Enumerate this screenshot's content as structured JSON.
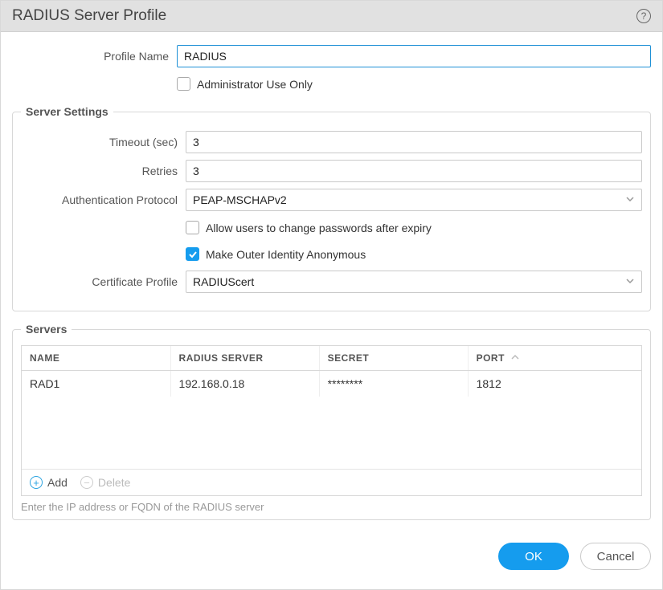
{
  "dialog": {
    "title": "RADIUS Server Profile",
    "help_icon": "?"
  },
  "profile": {
    "name_label": "Profile Name",
    "name_value": "RADIUS",
    "admin_only_label": "Administrator Use Only",
    "admin_only_checked": false
  },
  "settings": {
    "legend": "Server Settings",
    "timeout_label": "Timeout (sec)",
    "timeout_value": "3",
    "retries_label": "Retries",
    "retries_value": "3",
    "auth_protocol_label": "Authentication Protocol",
    "auth_protocol_value": "PEAP-MSCHAPv2",
    "allow_pw_change_label": "Allow users to change passwords after expiry",
    "allow_pw_change_checked": false,
    "outer_anon_label": "Make Outer Identity Anonymous",
    "outer_anon_checked": true,
    "cert_profile_label": "Certificate Profile",
    "cert_profile_value": "RADIUScert"
  },
  "servers": {
    "legend": "Servers",
    "columns": {
      "name": "NAME",
      "server": "RADIUS SERVER",
      "secret": "SECRET",
      "port": "PORT"
    },
    "rows": [
      {
        "name": "RAD1",
        "server": "192.168.0.18",
        "secret": "********",
        "port": "1812"
      }
    ],
    "add_label": "Add",
    "delete_label": "Delete",
    "hint": "Enter the IP address or FQDN of the RADIUS server"
  },
  "footer": {
    "ok_label": "OK",
    "cancel_label": "Cancel"
  }
}
